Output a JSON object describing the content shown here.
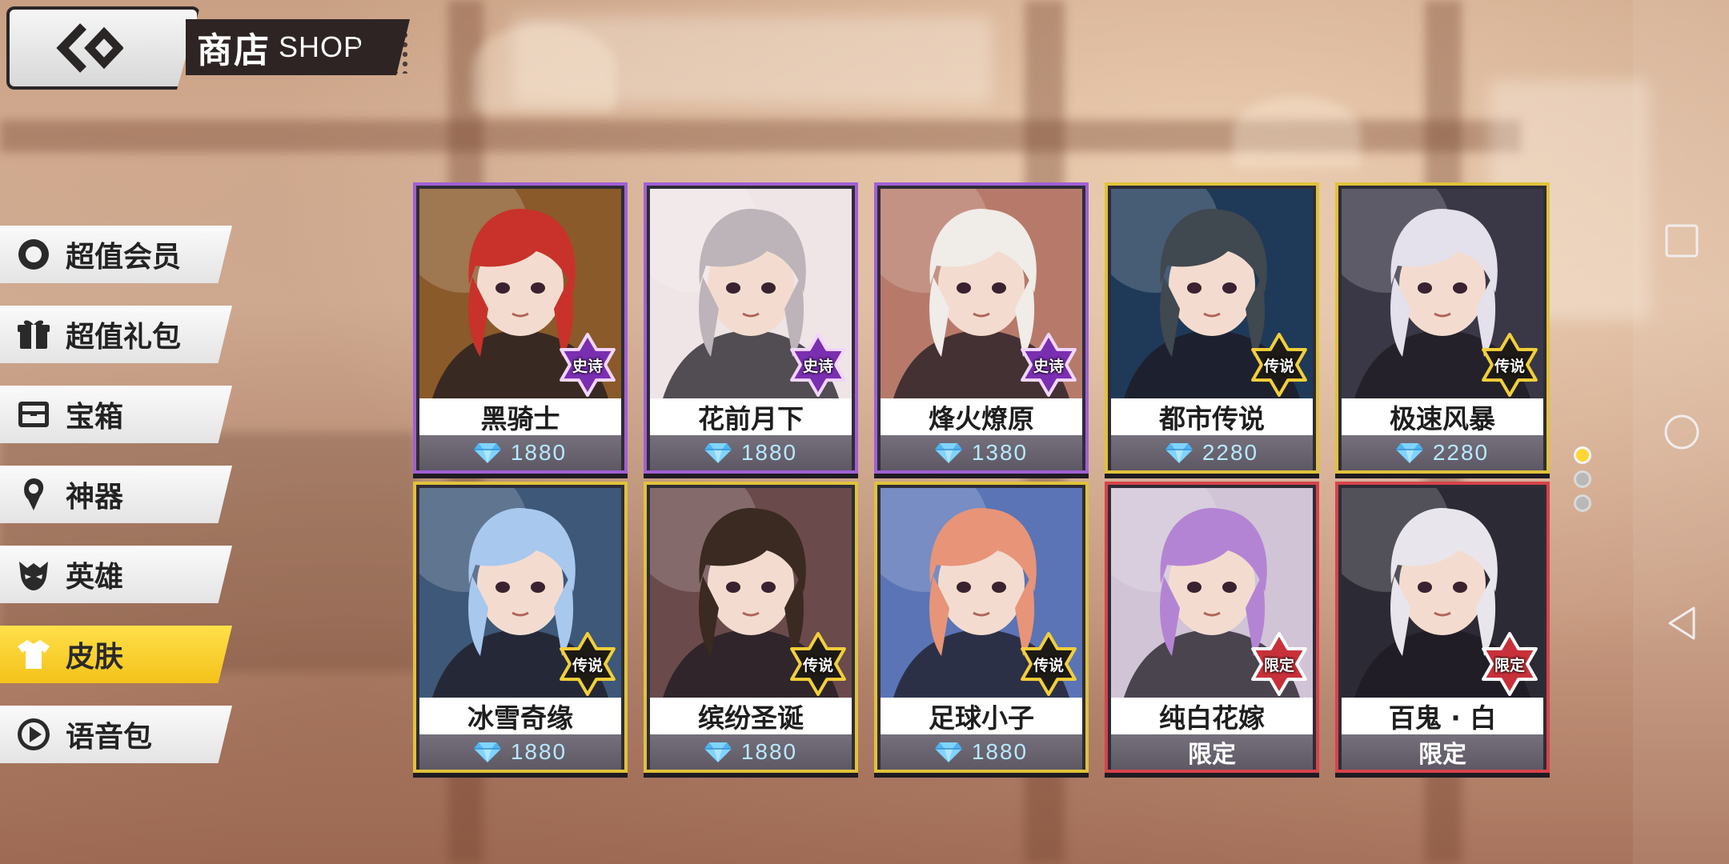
{
  "header": {
    "back_icon": "double-chevron-left-icon",
    "title_cn": "商店",
    "title_en": "SHOP"
  },
  "menu": {
    "items": [
      {
        "label": "超值会员",
        "icon": "vip-ring-icon",
        "active": false
      },
      {
        "label": "超值礼包",
        "icon": "gift-icon",
        "active": false
      },
      {
        "label": "宝箱",
        "icon": "chest-icon",
        "active": false
      },
      {
        "label": "神器",
        "icon": "artifact-icon",
        "active": false
      },
      {
        "label": "英雄",
        "icon": "hero-mask-icon",
        "active": false
      },
      {
        "label": "皮肤",
        "icon": "shirt-icon",
        "active": true
      },
      {
        "label": "语音包",
        "icon": "play-icon",
        "active": false
      }
    ]
  },
  "cards": [
    {
      "name": "黑骑士",
      "badge": "史诗",
      "rarity": "epic",
      "price": "1880",
      "price_type": "gem",
      "art_hue": "#8a5a2a",
      "hair": "#c8322a"
    },
    {
      "name": "花前月下",
      "badge": "史诗",
      "rarity": "epic",
      "price": "1880",
      "price_type": "gem",
      "art_hue": "#efe4e6",
      "hair": "#bcb4b8"
    },
    {
      "name": "烽火燎原",
      "badge": "史诗",
      "rarity": "epic",
      "price": "1380",
      "price_type": "gem",
      "art_hue": "#b77a6a",
      "hair": "#f0ece8"
    },
    {
      "name": "都市传说",
      "badge": "传说",
      "rarity": "legend",
      "price": "2280",
      "price_type": "gem",
      "art_hue": "#1f3a58",
      "hair": "#404850"
    },
    {
      "name": "极速风暴",
      "badge": "传说",
      "rarity": "legend",
      "price": "2280",
      "price_type": "gem",
      "art_hue": "#3a3846",
      "hair": "#e4e0ec"
    },
    {
      "name": "冰雪奇缘",
      "badge": "传说",
      "rarity": "legend",
      "price": "1880",
      "price_type": "gem",
      "art_hue": "#3d5878",
      "hair": "#a8c8ee"
    },
    {
      "name": "缤纷圣诞",
      "badge": "传说",
      "rarity": "legend",
      "price": "1880",
      "price_type": "gem",
      "art_hue": "#6a4a4a",
      "hair": "#3a2a22"
    },
    {
      "name": "足球小子",
      "badge": "传说",
      "rarity": "legend",
      "price": "1880",
      "price_type": "gem",
      "art_hue": "#5a74b6",
      "hair": "#e89478"
    },
    {
      "name": "纯白花嫁",
      "badge": "限定",
      "rarity": "limited",
      "price": "限定",
      "price_type": "limited",
      "art_hue": "#d0c4d6",
      "hair": "#b484d4"
    },
    {
      "name": "百鬼 · 白",
      "badge": "限定",
      "rarity": "limited",
      "price": "限定",
      "price_type": "limited",
      "art_hue": "#2c2a34",
      "hair": "#e8e6ec"
    }
  ],
  "pagination": {
    "pages": 3,
    "current": 1
  },
  "system_nav": {
    "buttons": [
      "recents-square-icon",
      "home-circle-icon",
      "back-triangle-icon"
    ]
  },
  "colors": {
    "epic": "#a060d4",
    "legend": "#e0c23a",
    "limited": "#d6434b",
    "active_menu": "#f4c21a",
    "price_text": "#b7e9ff"
  }
}
